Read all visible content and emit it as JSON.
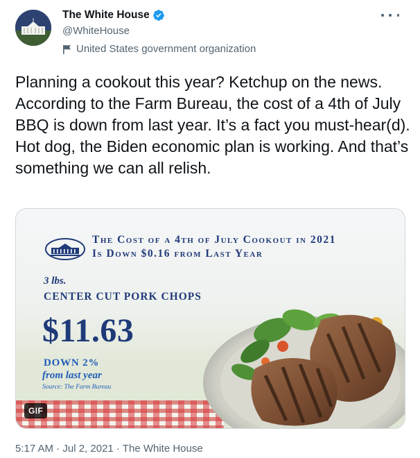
{
  "account": {
    "display_name": "The White House",
    "handle": "@WhiteHouse",
    "label": "United States government organization",
    "verified": true
  },
  "tweet": {
    "text": "Planning a cookout this year? Ketchup on the news. According to the Farm Bureau, the cost of a 4th of July BBQ is down from last year. It’s a fact you must-hear(d). Hot dog, the Biden economic plan is working. And that’s something we can all relish.",
    "timestamp": "5:17 AM · Jul 2, 2021 · The White House"
  },
  "media": {
    "heading_line1": "The Cost of a 4th of July Cookout in 2021",
    "heading_line2": "Is Down $0.16 from Last Year",
    "quantity": "3 lbs.",
    "product": "CENTER CUT PORK CHOPS",
    "price": "$11.63",
    "change": "DOWN 2%",
    "comparison": "from last year",
    "source": "Source: The Farm Bureau",
    "badge": "GIF"
  },
  "icons": {
    "verified": "verified-badge-icon",
    "flag": "flag-icon",
    "more": "more-options-icon"
  },
  "colors": {
    "verified_blue": "#1d9bf0",
    "heading_navy": "#1f3a78",
    "accent_blue": "#1f5cb8",
    "secondary_text": "#536471"
  }
}
